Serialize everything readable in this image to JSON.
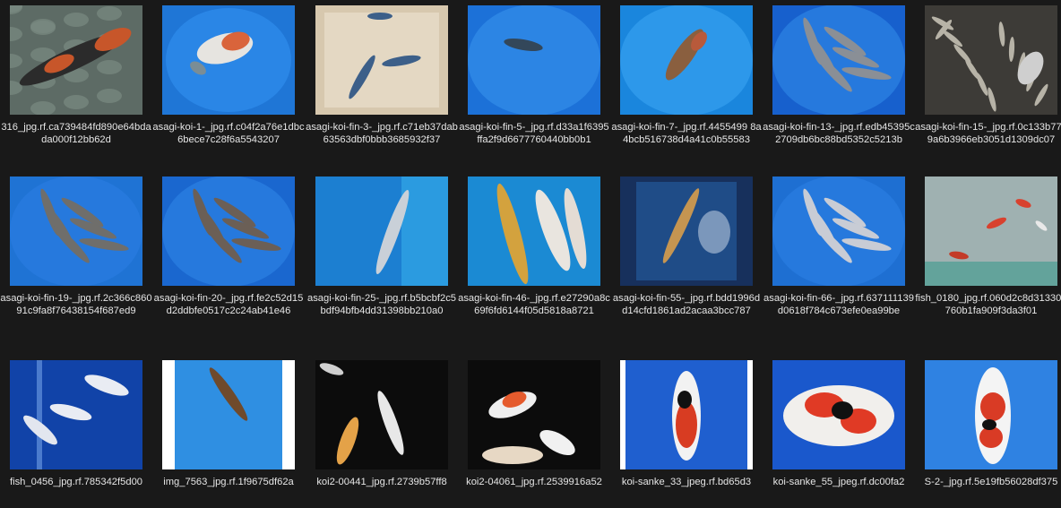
{
  "window": {
    "title": ""
  },
  "files": [
    {
      "name": "316_jpg.rf.ca739484fd890e64bdada000f12bb62d",
      "thumb": "pebble-koi",
      "colors": [
        "#5d6b65",
        "#c7562a"
      ]
    },
    {
      "name": "asagi-koi-1-_jpg.rf.c04f2a76e1dbc6bece7c28f6a5543207",
      "thumb": "blue-bowl-koi",
      "colors": [
        "#1f76d6",
        "#d9643b"
      ]
    },
    {
      "name": "asagi-koi-fin-3-_jpg.rf.c71eb37dab63563dbf0bbb3685932f37",
      "thumb": "pale-tray-koi",
      "colors": [
        "#d7c8ae",
        "#3c5f89"
      ]
    },
    {
      "name": "asagi-koi-fin-5-_jpg.rf.d33a1f6395ffa2f9d6677760440bb0b1",
      "thumb": "blue-bowl-dark",
      "colors": [
        "#1c71d8",
        "#33475a"
      ]
    },
    {
      "name": "asagi-koi-fin-7-_jpg.rf.4455499 8a4bcb516738d4a41c0b55583",
      "thumb": "blue-bowl-brown",
      "colors": [
        "#1a86dd",
        "#8a5f3f"
      ]
    },
    {
      "name": "asagi-koi-fin-13-_jpg.rf.edb45395c2709db6bc88bd5352c5213b",
      "thumb": "blue-bowl-many",
      "colors": [
        "#1760cd",
        "#8a8f96"
      ]
    },
    {
      "name": "asagi-koi-fin-15-_jpg.rf.0c133b77e9a6b3966eb3051d1309dc07",
      "thumb": "dark-tank-many",
      "colors": [
        "#6c6a60",
        "#cfcfcf"
      ]
    },
    {
      "name": "asagi-koi-fin-19-_jpg.rf.2c366c86091c9fa8f76438154f687ed9",
      "thumb": "blue-bowl-many",
      "colors": [
        "#1f73d4",
        "#6f6e6b"
      ]
    },
    {
      "name": "asagi-koi-fin-20-_jpg.rf.fe2c52d15d2ddbfe0517c2c24ab41e46",
      "thumb": "blue-bowl-many",
      "colors": [
        "#1a67cf",
        "#6b5f56"
      ]
    },
    {
      "name": "asagi-koi-fin-25-_jpg.rf.b5bcbf2c5bdf94bfb4dd31398bb210a0",
      "thumb": "blue-tub-single",
      "colors": [
        "#1e89d6",
        "#c9d0d8"
      ]
    },
    {
      "name": "asagi-koi-fin-46-_jpg.rf.e27290a8c69f6fd6144f05d5818a8721",
      "thumb": "blue-tub-gold",
      "colors": [
        "#1f92d6",
        "#d3a23e"
      ]
    },
    {
      "name": "asagi-koi-fin-55-_jpg.rf.bdd1996dd14cfd1861ad2acaa3bcc787",
      "thumb": "dark-blue-single",
      "colors": [
        "#17305c",
        "#c59551"
      ]
    },
    {
      "name": "asagi-koi-fin-66-_jpg.rf.637111139d0618f784c673efe0ea99be",
      "thumb": "blue-bowl-many",
      "colors": [
        "#1e6fd2",
        "#c8ccd5"
      ]
    },
    {
      "name": "fish_0180_jpg.rf.060d2c8d313309760b1fa909f3da3f01",
      "thumb": "aquarium",
      "colors": [
        "#c7d3d1",
        "#d8412e"
      ]
    },
    {
      "name": "fish_0456_jpg.rf.785342f5d00",
      "thumb": "blue-aquarium",
      "colors": [
        "#1347b0",
        "#e9ecf3"
      ]
    },
    {
      "name": "img_7563_jpg.rf.1f9675df62a",
      "thumb": "white-blue-single",
      "colors": [
        "#2a86e0",
        "#6f4a2c"
      ]
    },
    {
      "name": "koi2-00441_jpg.rf.2739b57ff8",
      "thumb": "dark-pond",
      "colors": [
        "#111111",
        "#e4a248"
      ]
    },
    {
      "name": "koi2-04061_jpg.rf.2539916a52",
      "thumb": "dark-pond-many",
      "colors": [
        "#111111",
        "#e55b2d"
      ]
    },
    {
      "name": "koi-sanke_33_jpeg.rf.bd65d3",
      "thumb": "sanke-single",
      "colors": [
        "#1a55c8",
        "#d83c22"
      ]
    },
    {
      "name": "koi-sanke_55_jpeg.rf.dc00fa2",
      "thumb": "sanke-wide",
      "colors": [
        "#1e5fd2",
        "#e03a25"
      ]
    },
    {
      "name": "S-2-_jpg.rf.5e19fb56028df375",
      "thumb": "sanke-top",
      "colors": [
        "#2d7de0",
        "#d93b25"
      ]
    }
  ]
}
